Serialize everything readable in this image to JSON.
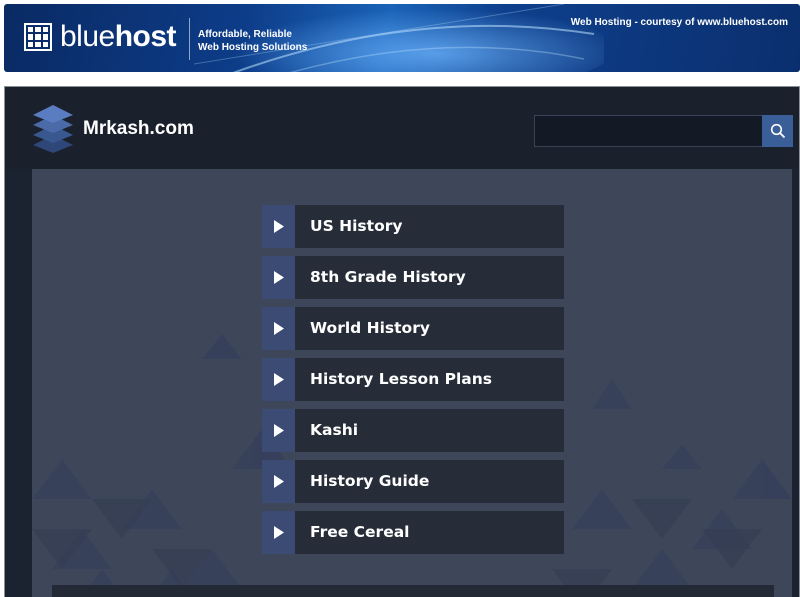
{
  "banner": {
    "brand_light": "blue",
    "brand_bold": "host",
    "tagline_line1": "Affordable, Reliable",
    "tagline_line2": "Web Hosting Solutions",
    "courtesy": "Web Hosting - courtesy of www.bluehost.com"
  },
  "site": {
    "name": "Mrkash.com"
  },
  "search": {
    "value": "",
    "placeholder": ""
  },
  "menu": {
    "items": [
      {
        "label": "US History"
      },
      {
        "label": "8th Grade History"
      },
      {
        "label": "World History"
      },
      {
        "label": "History Lesson Plans"
      },
      {
        "label": "Kashi"
      },
      {
        "label": "History Guide"
      },
      {
        "label": "Free Cereal"
      }
    ]
  },
  "icons": {
    "logo": "stacked-layers-icon",
    "search": "search-icon",
    "arrow": "play-arrow-icon",
    "bluehost": "grid-logo-icon"
  },
  "colors": {
    "banner_blue": "#0d3c88",
    "header_bg": "#1a202c",
    "content_bg": "#3e475a",
    "arrow_bg": "#3b4b73",
    "label_bg": "#262c38",
    "search_button": "#3a5e98"
  }
}
